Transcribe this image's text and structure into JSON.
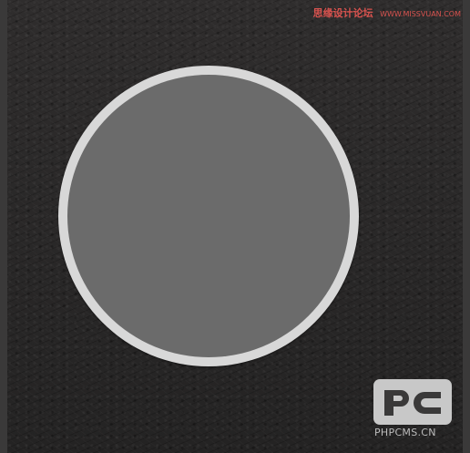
{
  "watermark": {
    "site_cn": "思缘设计论坛",
    "site_url": "WWW.MISSVUAN.COM"
  },
  "logo": {
    "mark": "PC",
    "site": "PHPCMS.CN"
  },
  "colors": {
    "background": "#2b2a2a",
    "ring": "#d8d8d8",
    "disc": "#6b6b6b",
    "logo": "#c8c8c8",
    "watermark_accent": "#d9534f"
  }
}
